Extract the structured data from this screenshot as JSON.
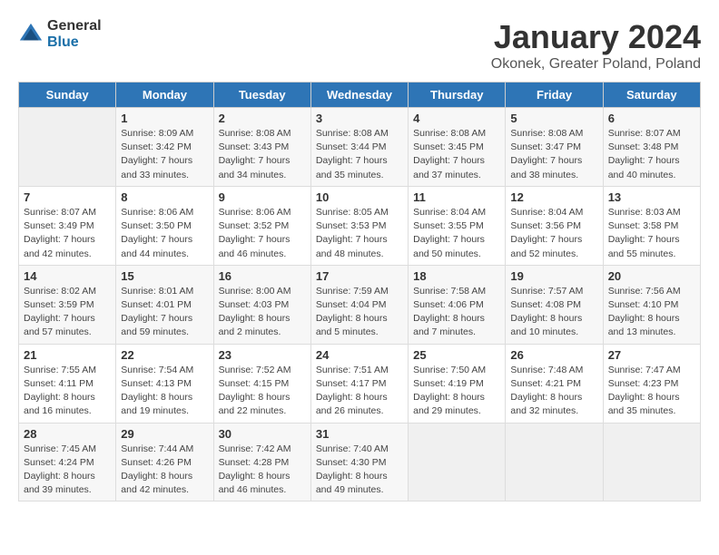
{
  "header": {
    "logo_general": "General",
    "logo_blue": "Blue",
    "title": "January 2024",
    "subtitle": "Okonek, Greater Poland, Poland"
  },
  "calendar": {
    "days_of_week": [
      "Sunday",
      "Monday",
      "Tuesday",
      "Wednesday",
      "Thursday",
      "Friday",
      "Saturday"
    ],
    "weeks": [
      [
        {
          "day": "",
          "sunrise": "",
          "sunset": "",
          "daylight": ""
        },
        {
          "day": "1",
          "sunrise": "Sunrise: 8:09 AM",
          "sunset": "Sunset: 3:42 PM",
          "daylight": "Daylight: 7 hours and 33 minutes."
        },
        {
          "day": "2",
          "sunrise": "Sunrise: 8:08 AM",
          "sunset": "Sunset: 3:43 PM",
          "daylight": "Daylight: 7 hours and 34 minutes."
        },
        {
          "day": "3",
          "sunrise": "Sunrise: 8:08 AM",
          "sunset": "Sunset: 3:44 PM",
          "daylight": "Daylight: 7 hours and 35 minutes."
        },
        {
          "day": "4",
          "sunrise": "Sunrise: 8:08 AM",
          "sunset": "Sunset: 3:45 PM",
          "daylight": "Daylight: 7 hours and 37 minutes."
        },
        {
          "day": "5",
          "sunrise": "Sunrise: 8:08 AM",
          "sunset": "Sunset: 3:47 PM",
          "daylight": "Daylight: 7 hours and 38 minutes."
        },
        {
          "day": "6",
          "sunrise": "Sunrise: 8:07 AM",
          "sunset": "Sunset: 3:48 PM",
          "daylight": "Daylight: 7 hours and 40 minutes."
        }
      ],
      [
        {
          "day": "7",
          "sunrise": "Sunrise: 8:07 AM",
          "sunset": "Sunset: 3:49 PM",
          "daylight": "Daylight: 7 hours and 42 minutes."
        },
        {
          "day": "8",
          "sunrise": "Sunrise: 8:06 AM",
          "sunset": "Sunset: 3:50 PM",
          "daylight": "Daylight: 7 hours and 44 minutes."
        },
        {
          "day": "9",
          "sunrise": "Sunrise: 8:06 AM",
          "sunset": "Sunset: 3:52 PM",
          "daylight": "Daylight: 7 hours and 46 minutes."
        },
        {
          "day": "10",
          "sunrise": "Sunrise: 8:05 AM",
          "sunset": "Sunset: 3:53 PM",
          "daylight": "Daylight: 7 hours and 48 minutes."
        },
        {
          "day": "11",
          "sunrise": "Sunrise: 8:04 AM",
          "sunset": "Sunset: 3:55 PM",
          "daylight": "Daylight: 7 hours and 50 minutes."
        },
        {
          "day": "12",
          "sunrise": "Sunrise: 8:04 AM",
          "sunset": "Sunset: 3:56 PM",
          "daylight": "Daylight: 7 hours and 52 minutes."
        },
        {
          "day": "13",
          "sunrise": "Sunrise: 8:03 AM",
          "sunset": "Sunset: 3:58 PM",
          "daylight": "Daylight: 7 hours and 55 minutes."
        }
      ],
      [
        {
          "day": "14",
          "sunrise": "Sunrise: 8:02 AM",
          "sunset": "Sunset: 3:59 PM",
          "daylight": "Daylight: 7 hours and 57 minutes."
        },
        {
          "day": "15",
          "sunrise": "Sunrise: 8:01 AM",
          "sunset": "Sunset: 4:01 PM",
          "daylight": "Daylight: 7 hours and 59 minutes."
        },
        {
          "day": "16",
          "sunrise": "Sunrise: 8:00 AM",
          "sunset": "Sunset: 4:03 PM",
          "daylight": "Daylight: 8 hours and 2 minutes."
        },
        {
          "day": "17",
          "sunrise": "Sunrise: 7:59 AM",
          "sunset": "Sunset: 4:04 PM",
          "daylight": "Daylight: 8 hours and 5 minutes."
        },
        {
          "day": "18",
          "sunrise": "Sunrise: 7:58 AM",
          "sunset": "Sunset: 4:06 PM",
          "daylight": "Daylight: 8 hours and 7 minutes."
        },
        {
          "day": "19",
          "sunrise": "Sunrise: 7:57 AM",
          "sunset": "Sunset: 4:08 PM",
          "daylight": "Daylight: 8 hours and 10 minutes."
        },
        {
          "day": "20",
          "sunrise": "Sunrise: 7:56 AM",
          "sunset": "Sunset: 4:10 PM",
          "daylight": "Daylight: 8 hours and 13 minutes."
        }
      ],
      [
        {
          "day": "21",
          "sunrise": "Sunrise: 7:55 AM",
          "sunset": "Sunset: 4:11 PM",
          "daylight": "Daylight: 8 hours and 16 minutes."
        },
        {
          "day": "22",
          "sunrise": "Sunrise: 7:54 AM",
          "sunset": "Sunset: 4:13 PM",
          "daylight": "Daylight: 8 hours and 19 minutes."
        },
        {
          "day": "23",
          "sunrise": "Sunrise: 7:52 AM",
          "sunset": "Sunset: 4:15 PM",
          "daylight": "Daylight: 8 hours and 22 minutes."
        },
        {
          "day": "24",
          "sunrise": "Sunrise: 7:51 AM",
          "sunset": "Sunset: 4:17 PM",
          "daylight": "Daylight: 8 hours and 26 minutes."
        },
        {
          "day": "25",
          "sunrise": "Sunrise: 7:50 AM",
          "sunset": "Sunset: 4:19 PM",
          "daylight": "Daylight: 8 hours and 29 minutes."
        },
        {
          "day": "26",
          "sunrise": "Sunrise: 7:48 AM",
          "sunset": "Sunset: 4:21 PM",
          "daylight": "Daylight: 8 hours and 32 minutes."
        },
        {
          "day": "27",
          "sunrise": "Sunrise: 7:47 AM",
          "sunset": "Sunset: 4:23 PM",
          "daylight": "Daylight: 8 hours and 35 minutes."
        }
      ],
      [
        {
          "day": "28",
          "sunrise": "Sunrise: 7:45 AM",
          "sunset": "Sunset: 4:24 PM",
          "daylight": "Daylight: 8 hours and 39 minutes."
        },
        {
          "day": "29",
          "sunrise": "Sunrise: 7:44 AM",
          "sunset": "Sunset: 4:26 PM",
          "daylight": "Daylight: 8 hours and 42 minutes."
        },
        {
          "day": "30",
          "sunrise": "Sunrise: 7:42 AM",
          "sunset": "Sunset: 4:28 PM",
          "daylight": "Daylight: 8 hours and 46 minutes."
        },
        {
          "day": "31",
          "sunrise": "Sunrise: 7:40 AM",
          "sunset": "Sunset: 4:30 PM",
          "daylight": "Daylight: 8 hours and 49 minutes."
        },
        {
          "day": "",
          "sunrise": "",
          "sunset": "",
          "daylight": ""
        },
        {
          "day": "",
          "sunrise": "",
          "sunset": "",
          "daylight": ""
        },
        {
          "day": "",
          "sunrise": "",
          "sunset": "",
          "daylight": ""
        }
      ]
    ]
  }
}
